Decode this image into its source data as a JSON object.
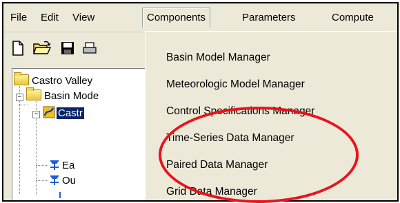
{
  "menubar": {
    "items": [
      "File",
      "Edit",
      "View",
      "Components",
      "Parameters",
      "Compute"
    ],
    "open_item": "Components"
  },
  "toolbar": {
    "buttons": [
      "new-document-icon",
      "open-folder-icon",
      "save-disk-icon",
      "print-icon"
    ]
  },
  "tree": {
    "root_label": "Castro Valley",
    "basin_models_label": "Basin Mode",
    "selected_label": "Castr",
    "child1_label": "Ea",
    "child2_label": "Ou"
  },
  "components_menu": {
    "items": [
      "Basin Model Manager",
      "Meteorologic Model Manager",
      "Control Specifications Manager",
      "Time-Series Data Manager",
      "Paired Data Manager",
      "Grid Data Manager"
    ]
  },
  "annotation": {
    "color": "#e8141c",
    "shape": "ellipse"
  },
  "colors": {
    "menu_bg": "#ece9d8",
    "selection_bg": "#0a246a"
  }
}
